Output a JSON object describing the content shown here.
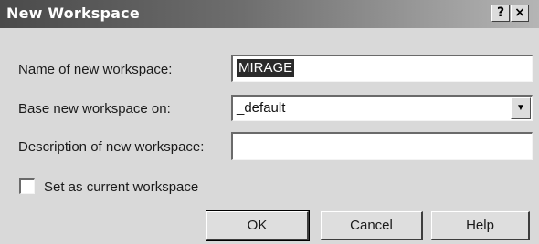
{
  "window": {
    "title": "New Workspace",
    "help_glyph": "?",
    "close_glyph": "×"
  },
  "form": {
    "name_label": "Name of new workspace:",
    "name_value": "MIRAGE",
    "base_label": "Base new workspace on:",
    "base_value": "_default",
    "description_label": "Description of new workspace:",
    "description_value": "",
    "set_current_label": "Set as current workspace",
    "set_current_checked": false
  },
  "buttons": {
    "ok": "OK",
    "cancel": "Cancel",
    "help": "Help"
  },
  "icons": {
    "help": "question-mark-icon",
    "close": "close-icon",
    "dropdown": "chevron-down-icon"
  }
}
